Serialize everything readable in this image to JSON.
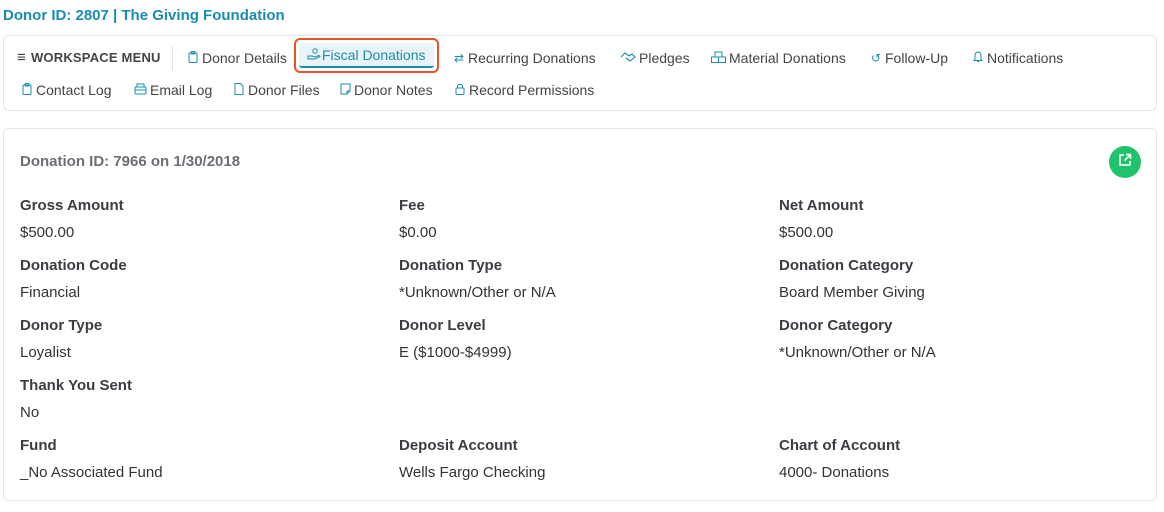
{
  "header": {
    "title": "Donor ID: 2807 | The Giving Foundation"
  },
  "menu": {
    "workspace_label": "WORKSPACE MENU",
    "tabs_row1": [
      {
        "label": "Donor Details",
        "icon": "clipboard-icon"
      },
      {
        "label": "Fiscal Donations",
        "icon": "hand-coin-icon",
        "active": true
      },
      {
        "label": "Recurring Donations",
        "icon": "sync-icon"
      },
      {
        "label": "Pledges",
        "icon": "handshake-icon"
      },
      {
        "label": "Material Donations",
        "icon": "boxes-icon"
      },
      {
        "label": "Follow-Up",
        "icon": "history-icon"
      },
      {
        "label": "Notifications",
        "icon": "bell-icon"
      }
    ],
    "tabs_row2": [
      {
        "label": "Contact Log",
        "icon": "clipboard-icon"
      },
      {
        "label": "Email Log",
        "icon": "mail-box-icon"
      },
      {
        "label": "Donor Files",
        "icon": "file-icon"
      },
      {
        "label": "Donor Notes",
        "icon": "note-icon"
      },
      {
        "label": "Record Permissions",
        "icon": "lock-icon"
      }
    ]
  },
  "donation": {
    "title": "Donation ID: 7966 on 1/30/2018",
    "fields": [
      {
        "label": "Gross Amount",
        "value": "$500.00"
      },
      {
        "label": "Fee",
        "value": "$0.00"
      },
      {
        "label": "Net Amount",
        "value": "$500.00"
      },
      {
        "label": "Donation Code",
        "value": "Financial"
      },
      {
        "label": "Donation Type",
        "value": "*Unknown/Other or N/A"
      },
      {
        "label": "Donation Category",
        "value": "Board Member Giving"
      },
      {
        "label": "Donor Type",
        "value": "Loyalist"
      },
      {
        "label": "Donor Level",
        "value": "E ($1000-$4999)"
      },
      {
        "label": "Donor Category",
        "value": "*Unknown/Other or N/A"
      },
      {
        "label": "Thank You Sent",
        "value": "No"
      },
      {
        "label": "Fund",
        "value": "_No Associated Fund"
      },
      {
        "label": "Deposit Account",
        "value": "Wells Fargo Checking"
      },
      {
        "label": "Chart of Account",
        "value": "4000- Donations"
      }
    ]
  },
  "colors": {
    "accent": "#1a8cb0",
    "highlight": "#e8542a",
    "action": "#20c36b"
  }
}
